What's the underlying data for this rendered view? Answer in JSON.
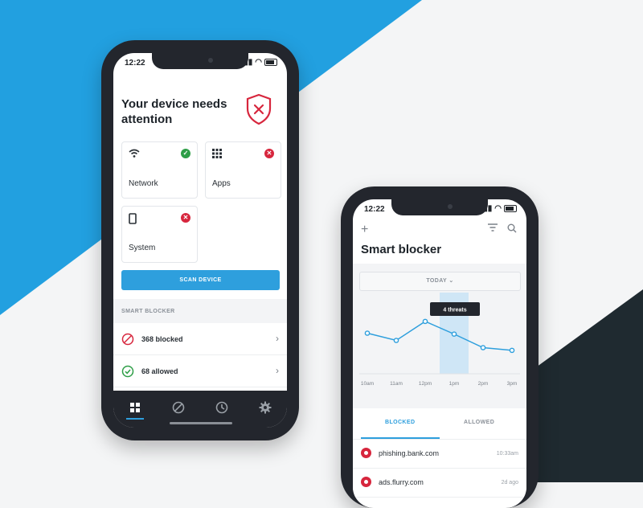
{
  "status": {
    "time": "12:22"
  },
  "device": {
    "headline": "Your device needs attention",
    "cards": [
      {
        "label": "Network",
        "state": "ok",
        "icon": "wifi-icon"
      },
      {
        "label": "Apps",
        "state": "error",
        "icon": "grid-icon"
      },
      {
        "label": "System",
        "state": "error",
        "icon": "phone-icon"
      }
    ],
    "scan_label": "SCAN DEVICE",
    "section_title": "SMART BLOCKER",
    "rows": [
      {
        "label": "368 blocked",
        "icon": "blocked-icon"
      },
      {
        "label": "68 allowed",
        "icon": "check-circle-icon"
      }
    ]
  },
  "blocker": {
    "title": "Smart blocker",
    "range": "TODAY",
    "tooltip": "4 threats",
    "tabs": [
      "BLOCKED",
      "ALLOWED"
    ],
    "domains": [
      {
        "name": "phishing.bank.com",
        "time": "10:33am"
      },
      {
        "name": "ads.flurry.com",
        "time": "2d ago"
      }
    ]
  },
  "colors": {
    "accent": "#2e9fdd",
    "error": "#d7263d",
    "success": "#2e9e47",
    "dark": "#23262d"
  },
  "chart_data": {
    "type": "line",
    "x": [
      "10am",
      "11am",
      "12pm",
      "1pm",
      "2pm",
      "3pm"
    ],
    "series": [
      {
        "values": [
          4.4,
          3.6,
          5.7,
          4.3,
          2.8,
          2.5
        ]
      }
    ],
    "highlight": "1pm",
    "ylim": [
      0,
      8
    ],
    "grid": false
  }
}
